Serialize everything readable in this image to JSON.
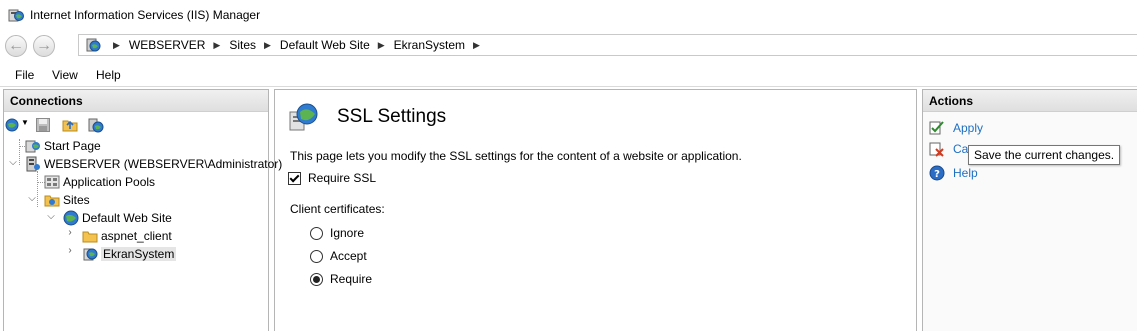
{
  "window": {
    "title": "Internet Information Services (IIS) Manager"
  },
  "address": {
    "crumbs": [
      "WEBSERVER",
      "Sites",
      "Default Web Site",
      "EkranSystem"
    ]
  },
  "menu": {
    "file": "File",
    "view": "View",
    "help": "Help"
  },
  "connections": {
    "header": "Connections",
    "tree": {
      "start_page": "Start Page",
      "server": "WEBSERVER (WEBSERVER\\Administrator)",
      "app_pools": "Application Pools",
      "sites": "Sites",
      "default_site": "Default Web Site",
      "aspnet_client": "aspnet_client",
      "ekran": "EkranSystem"
    }
  },
  "ssl": {
    "title": "SSL Settings",
    "description": "This page lets you modify the SSL settings for the content of a website or application.",
    "require_ssl_label": "Require SSL",
    "require_ssl_checked": true,
    "client_cert_label": "Client certificates:",
    "options": [
      "Ignore",
      "Accept",
      "Require"
    ],
    "selected_option": "Require"
  },
  "actions": {
    "header": "Actions",
    "apply": "Apply",
    "cancel_visible": "Can",
    "help": "Help",
    "tooltip": "Save the current changes."
  },
  "colors": {
    "link": "#1e6fc2",
    "header_bg": "#e8e8e8",
    "selection": "#e5e5e5"
  }
}
